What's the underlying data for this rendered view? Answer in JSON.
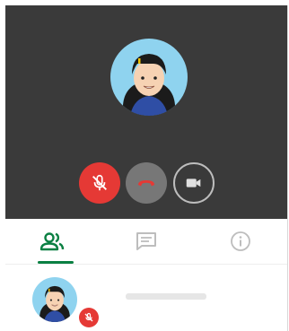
{
  "window": {
    "title": ""
  },
  "stage": {
    "background": "#3a3a3a",
    "avatar_icon": "woman-avatar-icon"
  },
  "controls": {
    "mic": {
      "icon": "mic-off-icon",
      "state": "muted",
      "color": "#e53935"
    },
    "hangup": {
      "icon": "phone-hangup-icon",
      "color": "#777777"
    },
    "video": {
      "icon": "videocam-icon",
      "state": "off"
    }
  },
  "tabs": [
    {
      "icon": "people-icon",
      "active": true
    },
    {
      "icon": "chat-icon",
      "active": false
    },
    {
      "icon": "info-icon",
      "active": false
    }
  ],
  "accent_color": "#0b8043",
  "participants": [
    {
      "avatar_icon": "woman-avatar-icon",
      "muted": true,
      "name": ""
    }
  ]
}
